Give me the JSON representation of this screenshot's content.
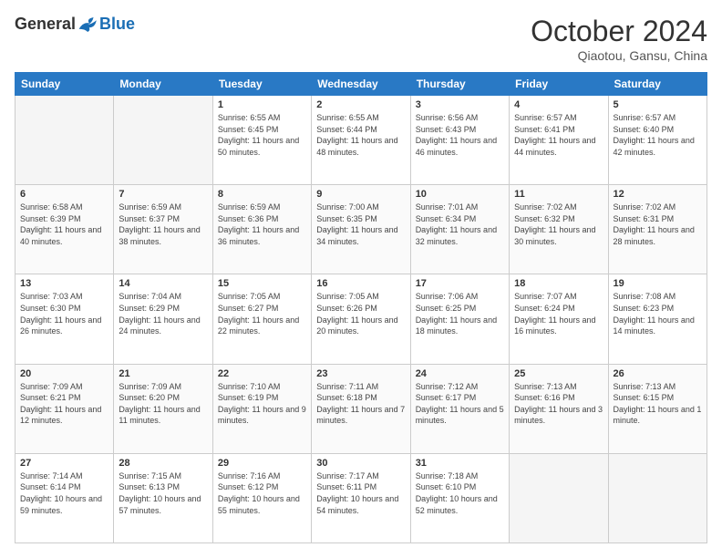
{
  "header": {
    "logo_general": "General",
    "logo_blue": "Blue",
    "title": "October 2024",
    "location": "Qiaotou, Gansu, China"
  },
  "calendar": {
    "days_of_week": [
      "Sunday",
      "Monday",
      "Tuesday",
      "Wednesday",
      "Thursday",
      "Friday",
      "Saturday"
    ],
    "weeks": [
      [
        {
          "day": "",
          "empty": true
        },
        {
          "day": "",
          "empty": true
        },
        {
          "day": "1",
          "sunrise": "6:55 AM",
          "sunset": "6:45 PM",
          "daylight": "11 hours and 50 minutes."
        },
        {
          "day": "2",
          "sunrise": "6:55 AM",
          "sunset": "6:44 PM",
          "daylight": "11 hours and 48 minutes."
        },
        {
          "day": "3",
          "sunrise": "6:56 AM",
          "sunset": "6:43 PM",
          "daylight": "11 hours and 46 minutes."
        },
        {
          "day": "4",
          "sunrise": "6:57 AM",
          "sunset": "6:41 PM",
          "daylight": "11 hours and 44 minutes."
        },
        {
          "day": "5",
          "sunrise": "6:57 AM",
          "sunset": "6:40 PM",
          "daylight": "11 hours and 42 minutes."
        }
      ],
      [
        {
          "day": "6",
          "sunrise": "6:58 AM",
          "sunset": "6:39 PM",
          "daylight": "11 hours and 40 minutes."
        },
        {
          "day": "7",
          "sunrise": "6:59 AM",
          "sunset": "6:37 PM",
          "daylight": "11 hours and 38 minutes."
        },
        {
          "day": "8",
          "sunrise": "6:59 AM",
          "sunset": "6:36 PM",
          "daylight": "11 hours and 36 minutes."
        },
        {
          "day": "9",
          "sunrise": "7:00 AM",
          "sunset": "6:35 PM",
          "daylight": "11 hours and 34 minutes."
        },
        {
          "day": "10",
          "sunrise": "7:01 AM",
          "sunset": "6:34 PM",
          "daylight": "11 hours and 32 minutes."
        },
        {
          "day": "11",
          "sunrise": "7:02 AM",
          "sunset": "6:32 PM",
          "daylight": "11 hours and 30 minutes."
        },
        {
          "day": "12",
          "sunrise": "7:02 AM",
          "sunset": "6:31 PM",
          "daylight": "11 hours and 28 minutes."
        }
      ],
      [
        {
          "day": "13",
          "sunrise": "7:03 AM",
          "sunset": "6:30 PM",
          "daylight": "11 hours and 26 minutes."
        },
        {
          "day": "14",
          "sunrise": "7:04 AM",
          "sunset": "6:29 PM",
          "daylight": "11 hours and 24 minutes."
        },
        {
          "day": "15",
          "sunrise": "7:05 AM",
          "sunset": "6:27 PM",
          "daylight": "11 hours and 22 minutes."
        },
        {
          "day": "16",
          "sunrise": "7:05 AM",
          "sunset": "6:26 PM",
          "daylight": "11 hours and 20 minutes."
        },
        {
          "day": "17",
          "sunrise": "7:06 AM",
          "sunset": "6:25 PM",
          "daylight": "11 hours and 18 minutes."
        },
        {
          "day": "18",
          "sunrise": "7:07 AM",
          "sunset": "6:24 PM",
          "daylight": "11 hours and 16 minutes."
        },
        {
          "day": "19",
          "sunrise": "7:08 AM",
          "sunset": "6:23 PM",
          "daylight": "11 hours and 14 minutes."
        }
      ],
      [
        {
          "day": "20",
          "sunrise": "7:09 AM",
          "sunset": "6:21 PM",
          "daylight": "11 hours and 12 minutes."
        },
        {
          "day": "21",
          "sunrise": "7:09 AM",
          "sunset": "6:20 PM",
          "daylight": "11 hours and 11 minutes."
        },
        {
          "day": "22",
          "sunrise": "7:10 AM",
          "sunset": "6:19 PM",
          "daylight": "11 hours and 9 minutes."
        },
        {
          "day": "23",
          "sunrise": "7:11 AM",
          "sunset": "6:18 PM",
          "daylight": "11 hours and 7 minutes."
        },
        {
          "day": "24",
          "sunrise": "7:12 AM",
          "sunset": "6:17 PM",
          "daylight": "11 hours and 5 minutes."
        },
        {
          "day": "25",
          "sunrise": "7:13 AM",
          "sunset": "6:16 PM",
          "daylight": "11 hours and 3 minutes."
        },
        {
          "day": "26",
          "sunrise": "7:13 AM",
          "sunset": "6:15 PM",
          "daylight": "11 hours and 1 minute."
        }
      ],
      [
        {
          "day": "27",
          "sunrise": "7:14 AM",
          "sunset": "6:14 PM",
          "daylight": "10 hours and 59 minutes."
        },
        {
          "day": "28",
          "sunrise": "7:15 AM",
          "sunset": "6:13 PM",
          "daylight": "10 hours and 57 minutes."
        },
        {
          "day": "29",
          "sunrise": "7:16 AM",
          "sunset": "6:12 PM",
          "daylight": "10 hours and 55 minutes."
        },
        {
          "day": "30",
          "sunrise": "7:17 AM",
          "sunset": "6:11 PM",
          "daylight": "10 hours and 54 minutes."
        },
        {
          "day": "31",
          "sunrise": "7:18 AM",
          "sunset": "6:10 PM",
          "daylight": "10 hours and 52 minutes."
        },
        {
          "day": "",
          "empty": true
        },
        {
          "day": "",
          "empty": true
        }
      ]
    ]
  }
}
